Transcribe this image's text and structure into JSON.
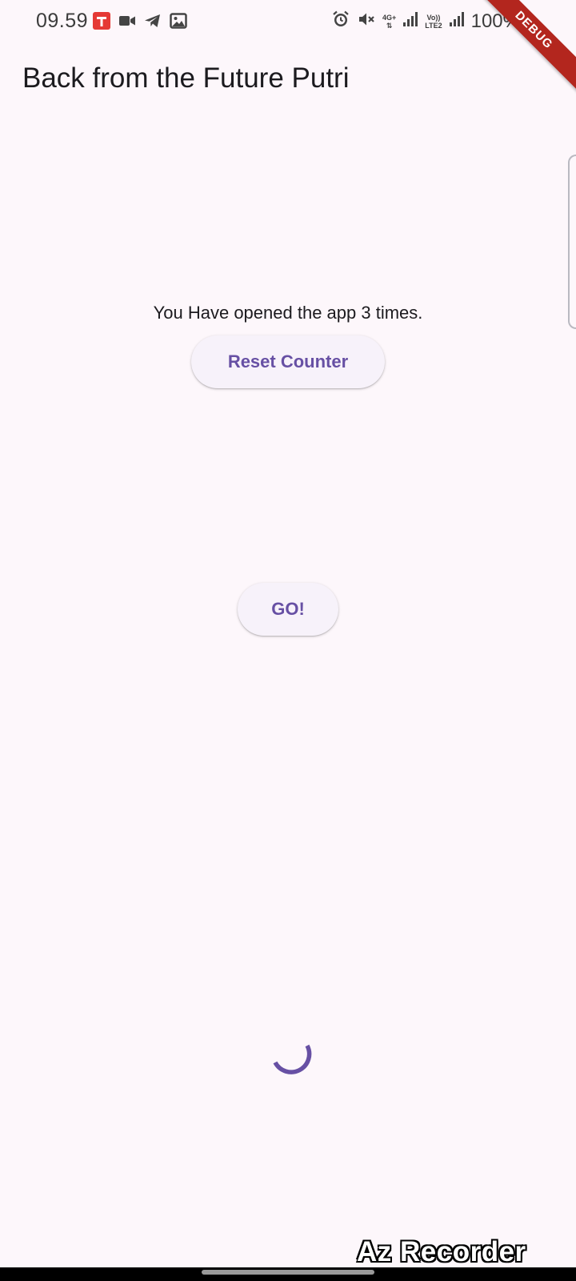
{
  "status_bar": {
    "time": "09.59",
    "battery": "100%",
    "network_top": "4G+",
    "network_sim2_top": "Vo))",
    "network_sim2_bottom": "LTE2",
    "left_icons": [
      "app-notification-icon",
      "video-camera-icon",
      "telegram-icon",
      "image-icon"
    ],
    "right_icons": [
      "alarm-icon",
      "mute-icon",
      "signal-icon",
      "battery-icon"
    ]
  },
  "debug_banner": "DEBUG",
  "app_bar": {
    "title": "Back from the Future Putri"
  },
  "main": {
    "counter_text": "You Have opened the app 3 times.",
    "reset_button_label": "Reset Counter",
    "go_button_label": "GO!"
  },
  "watermark": "Az Recorder",
  "colors": {
    "background": "#fdf7fb",
    "primary": "#6750a4",
    "button_surface": "#f7f2fa",
    "debug_ribbon": "#b3261e"
  }
}
